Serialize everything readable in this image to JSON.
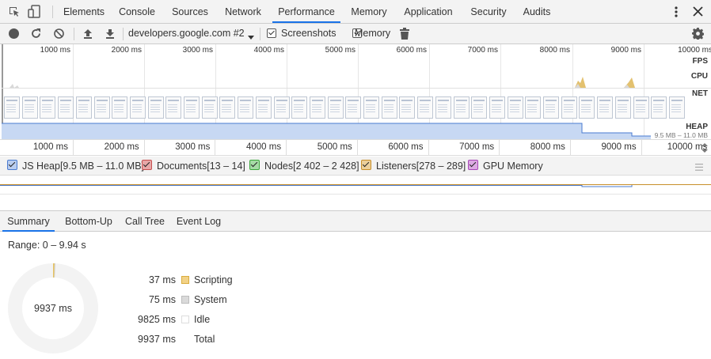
{
  "tabs": [
    {
      "label": "Elements",
      "active": false
    },
    {
      "label": "Console",
      "active": false
    },
    {
      "label": "Sources",
      "active": false
    },
    {
      "label": "Network",
      "active": false
    },
    {
      "label": "Performance",
      "active": true
    },
    {
      "label": "Memory",
      "active": false
    },
    {
      "label": "Application",
      "active": false
    },
    {
      "label": "Security",
      "active": false
    },
    {
      "label": "Audits",
      "active": false
    }
  ],
  "toolbar": {
    "profile_select": "developers.google.com #2",
    "screenshots_label": "Screenshots",
    "screenshots_checked": true,
    "memory_label": "Memory",
    "memory_checked": true
  },
  "overview": {
    "time_ticks": [
      "1000 ms",
      "2000 ms",
      "3000 ms",
      "4000 ms",
      "5000 ms",
      "6000 ms",
      "7000 ms",
      "8000 ms",
      "9000 ms",
      "10000 ms"
    ],
    "row_labels": {
      "fps": "FPS",
      "cpu": "CPU",
      "net": "NET",
      "heap": "HEAP"
    },
    "heap_range": "9.5 MB – 11.0 MB",
    "screenshot_count": 38
  },
  "ruler": {
    "ticks": [
      "1000 ms",
      "2000 ms",
      "3000 ms",
      "4000 ms",
      "5000 ms",
      "6000 ms",
      "7000 ms",
      "8000 ms",
      "9000 ms",
      "10000 ms"
    ]
  },
  "legend": [
    {
      "label": "JS Heap[9.5 MB – 11.0 MB]",
      "color": "#4a7bd0",
      "bg": "#b9cdef",
      "checked": true
    },
    {
      "label": "Documents[13 – 14]",
      "color": "#c75050",
      "bg": "#e7a7a7",
      "checked": true
    },
    {
      "label": "Nodes[2 402 – 2 428]",
      "color": "#3ca83c",
      "bg": "#a6dba6",
      "checked": true
    },
    {
      "label": "Listeners[278 – 289]",
      "color": "#c88f2a",
      "bg": "#ebcf9b",
      "checked": true
    },
    {
      "label": "GPU Memory",
      "color": "#a847b8",
      "bg": "#dcaae3",
      "checked": true
    }
  ],
  "bottom_tabs": [
    {
      "label": "Summary",
      "active": true
    },
    {
      "label": "Bottom-Up",
      "active": false
    },
    {
      "label": "Call Tree",
      "active": false
    },
    {
      "label": "Event Log",
      "active": false
    }
  ],
  "summary": {
    "range": "Range: 0 – 9.94 s",
    "donut_total": "9937 ms",
    "rows": [
      {
        "value": "37 ms",
        "label": "Scripting",
        "fill": "#f2d287",
        "border": "#d9ac3e"
      },
      {
        "value": "75 ms",
        "label": "System",
        "fill": "#dadada",
        "border": "#bdbdbd"
      },
      {
        "value": "9825 ms",
        "label": "Idle",
        "fill": "#ffffff",
        "border": "#dddddd"
      },
      {
        "value": "9937 ms",
        "label": "Total",
        "fill": "none",
        "border": "none"
      }
    ]
  }
}
